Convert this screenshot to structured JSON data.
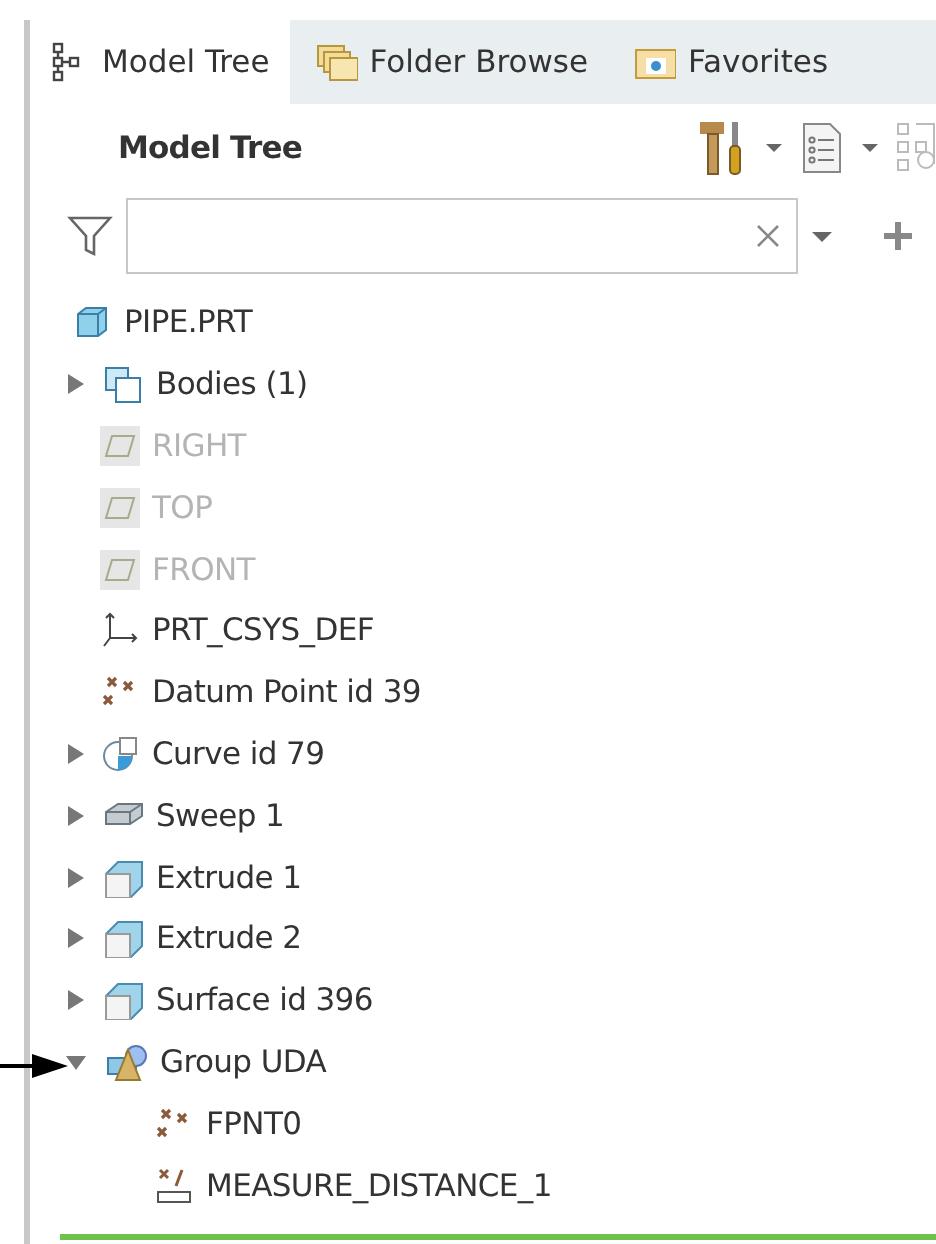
{
  "tabs": [
    {
      "label": "Model Tree",
      "kind": "tree",
      "selected": true
    },
    {
      "label": "Folder Browse",
      "kind": "folders",
      "selected": false
    },
    {
      "label": "Favorites",
      "kind": "favorite",
      "selected": false
    }
  ],
  "panel_title": "Model Tree",
  "tree": [
    {
      "label": "PIPE.PRT",
      "kind": "part",
      "children": [
        {
          "label": "Bodies (1)",
          "kind": "bodies",
          "expanded": false
        },
        {
          "label": "RIGHT",
          "kind": "plane",
          "disabled": true
        },
        {
          "label": "TOP",
          "kind": "plane",
          "disabled": true
        },
        {
          "label": "FRONT",
          "kind": "plane",
          "disabled": true
        },
        {
          "label": "PRT_CSYS_DEF",
          "kind": "csys"
        },
        {
          "label": "Datum Point id 39",
          "kind": "points"
        },
        {
          "label": "Curve id 79",
          "kind": "curve",
          "expanded": false
        },
        {
          "label": "Sweep 1",
          "kind": "sweep",
          "expanded": false
        },
        {
          "label": "Extrude 1",
          "kind": "extrude",
          "expanded": false
        },
        {
          "label": "Extrude 2",
          "kind": "extrude",
          "expanded": false
        },
        {
          "label": "Surface id 396",
          "kind": "extrude",
          "expanded": false
        },
        {
          "label": "Group UDA",
          "kind": "group",
          "expanded": true,
          "children": [
            {
              "label": "FPNT0",
              "kind": "points"
            },
            {
              "label": "MEASURE_DISTANCE_1",
              "kind": "measure"
            }
          ]
        }
      ]
    }
  ]
}
